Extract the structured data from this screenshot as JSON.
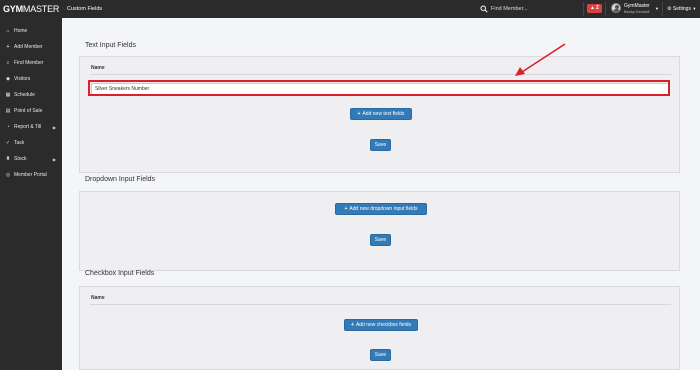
{
  "app": {
    "logo_gym": "GYM",
    "logo_master": "MASTER",
    "page_title": "Custom Fields"
  },
  "topbar": {
    "search_placeholder": "Find Member...",
    "notification_count": "2",
    "user_name": "GymMaster",
    "user_sub": "Becky Kendall",
    "settings_label": "Settings"
  },
  "sidebar": {
    "items": [
      {
        "label": "Home",
        "icon": "home-icon"
      },
      {
        "label": "Add Member",
        "icon": "plus-icon"
      },
      {
        "label": "Find Member",
        "icon": "search-icon"
      },
      {
        "label": "Visitors",
        "icon": "tag-icon"
      },
      {
        "label": "Schedule",
        "icon": "calendar-icon"
      },
      {
        "label": "Point of Sale",
        "icon": "store-icon"
      },
      {
        "label": "Report & Till",
        "icon": "chart-icon",
        "has_children": true
      },
      {
        "label": "Task",
        "icon": "check-icon"
      },
      {
        "label": "Stock",
        "icon": "trophy-icon",
        "has_children": true
      },
      {
        "label": "Member Portal",
        "icon": "globe-icon"
      }
    ]
  },
  "sections": {
    "text": {
      "title": "Text Input Fields",
      "column_name": "Name",
      "field_value": "Silver Sneakers Number",
      "add_label": "Add new text fields",
      "save_label": "Save"
    },
    "dropdown": {
      "title": "Dropdown Input Fields",
      "add_label": "Add new dropdown input fields",
      "save_label": "Save"
    },
    "checkbox": {
      "title": "Checkbox Input Fields",
      "column_name": "Name",
      "add_label": "Add new checkbox fields",
      "save_label": "Save"
    }
  },
  "colors": {
    "topbar": "#2b2b2b",
    "primary_button": "#337ab7",
    "highlight": "#d9202b",
    "notification": "#d9433f"
  }
}
